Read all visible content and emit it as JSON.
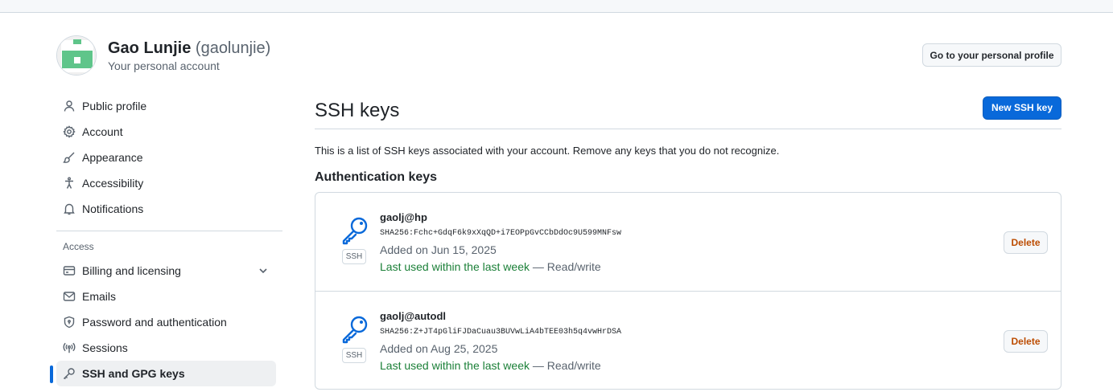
{
  "account": {
    "display_name": "Gao Lunjie",
    "login": "(gaolunjie)",
    "subtitle": "Your personal account",
    "avatar_color": "#5fc58a",
    "profile_button": "Go to your personal profile"
  },
  "sidebar": {
    "items": [
      {
        "label": "Public profile",
        "icon": "person-icon"
      },
      {
        "label": "Account",
        "icon": "gear-icon"
      },
      {
        "label": "Appearance",
        "icon": "paintbrush-icon"
      },
      {
        "label": "Accessibility",
        "icon": "accessibility-icon"
      },
      {
        "label": "Notifications",
        "icon": "bell-icon"
      }
    ],
    "access_label": "Access",
    "access_items": [
      {
        "label": "Billing and licensing",
        "icon": "credit-card-icon",
        "expandable": true
      },
      {
        "label": "Emails",
        "icon": "mail-icon"
      },
      {
        "label": "Password and authentication",
        "icon": "shield-lock-icon"
      },
      {
        "label": "Sessions",
        "icon": "broadcast-icon"
      },
      {
        "label": "SSH and GPG keys",
        "icon": "key-icon",
        "active": true
      }
    ]
  },
  "main": {
    "title": "SSH keys",
    "new_button": "New SSH key",
    "intro": "This is a list of SSH keys associated with your account. Remove any keys that you do not recognize.",
    "section_title": "Authentication keys",
    "keys": [
      {
        "title": "gaolj@hp",
        "fingerprint": "SHA256:Fchc+GdqF6k9xXqQD+i7EOPpGvCCbDdOc9U599MNFsw",
        "added": "Added on Jun 15, 2025",
        "last_used": "Last used within the last week",
        "access": "— Read/write",
        "badge": "SSH",
        "delete_label": "Delete"
      },
      {
        "title": "gaolj@autodl",
        "fingerprint": "SHA256:Z+JT4pGliFJDaCuau3BUVwLiA4bTEE03h5q4vwHrDSA",
        "added": "Added on Aug 25, 2025",
        "last_used": "Last used within the last week",
        "access": "— Read/write",
        "badge": "SSH",
        "delete_label": "Delete"
      }
    ]
  },
  "colors": {
    "accent": "#0969da",
    "success": "#1a7f37",
    "muted": "#59636e"
  }
}
